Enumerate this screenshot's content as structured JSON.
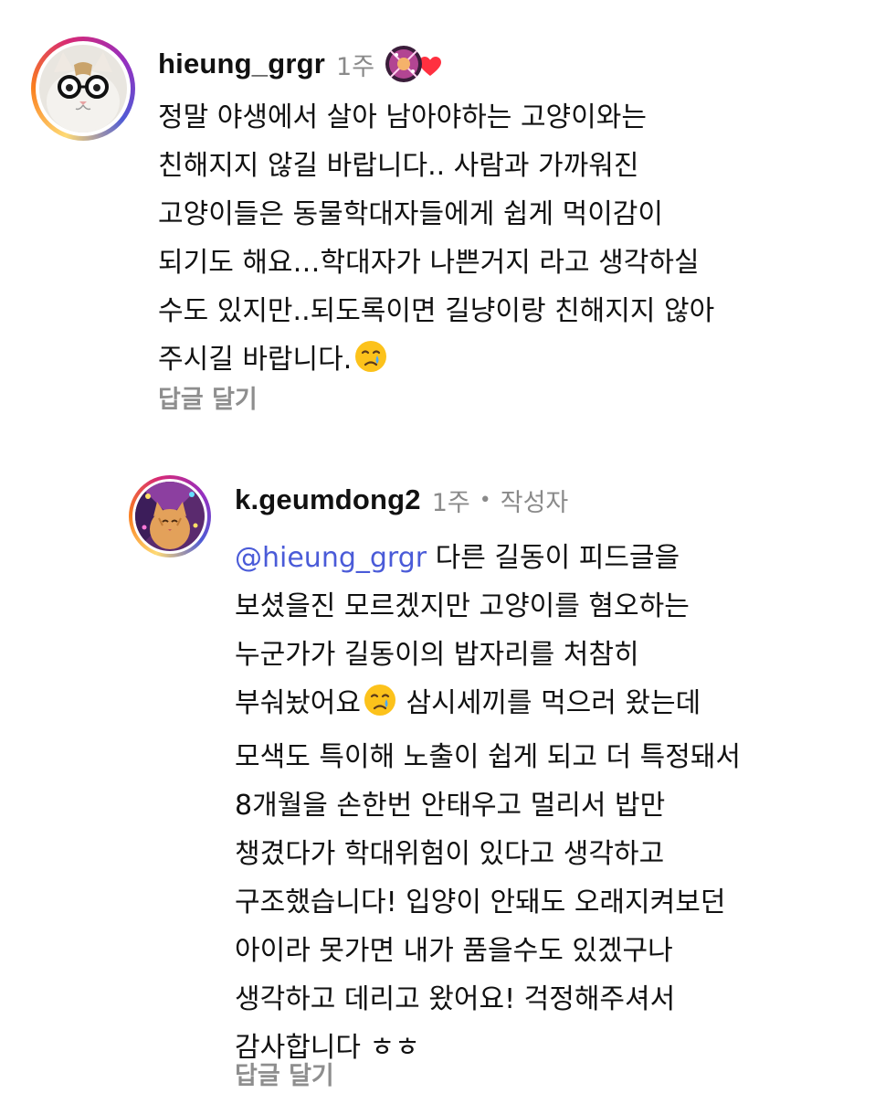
{
  "comments": [
    {
      "username": "hieung_grgr",
      "time": "1주",
      "avatar": "cat-with-glasses-avatar",
      "liked_by_author": true,
      "lines": [
        "정말 야생에서 살아 남아야하는 고양이와는",
        "친해지지 않길 바랍니다.. 사람과 가까워진",
        "고양이들은 동물학대자들에게 쉽게 먹이감이",
        "되기도 해요…학대자가 나쁜거지 라고 생각하실",
        "수도 있지만..되도록이면 길냥이랑 친해지지 않아",
        "주시길 바랍니다."
      ],
      "end_emoji": "crying-face",
      "reply_label": "답글 달기"
    },
    {
      "username": "k.geumdong2",
      "time": "1주",
      "separator": "•",
      "author_tag": "작성자",
      "avatar": "orange-cat-avatar",
      "mention": "@hieung_grgr",
      "lines": [
        " 다른 길동이 피드글을",
        "보셨을진 모르겠지만 고양이를 혐오하는",
        "누군가가 길동이의 밥자리를 처참히",
        "부숴놨어요",
        " 삼시세끼를 먹으러 왔는데",
        "모색도 특이해 노출이 쉽게 되고 더 특정돼서",
        "8개월을 손한번 안태우고 멀리서 밥만",
        "챙겼다가 학대위험이 있다고 생각하고",
        "구조했습니다! 입양이 안돼도 오래지켜보던",
        "아이라 못가면 내가 품을수도 있겠구나",
        "생각하고 데리고 왔어요! 걱정해주셔서",
        "감사합니다 ㅎㅎ"
      ],
      "mid_emoji": "crying-face",
      "reply_label": "답글 달기"
    }
  ],
  "colors": {
    "text": "#111111",
    "muted": "#8a8a8a",
    "mention": "#4a5bd8",
    "heart": "#ff3040"
  }
}
